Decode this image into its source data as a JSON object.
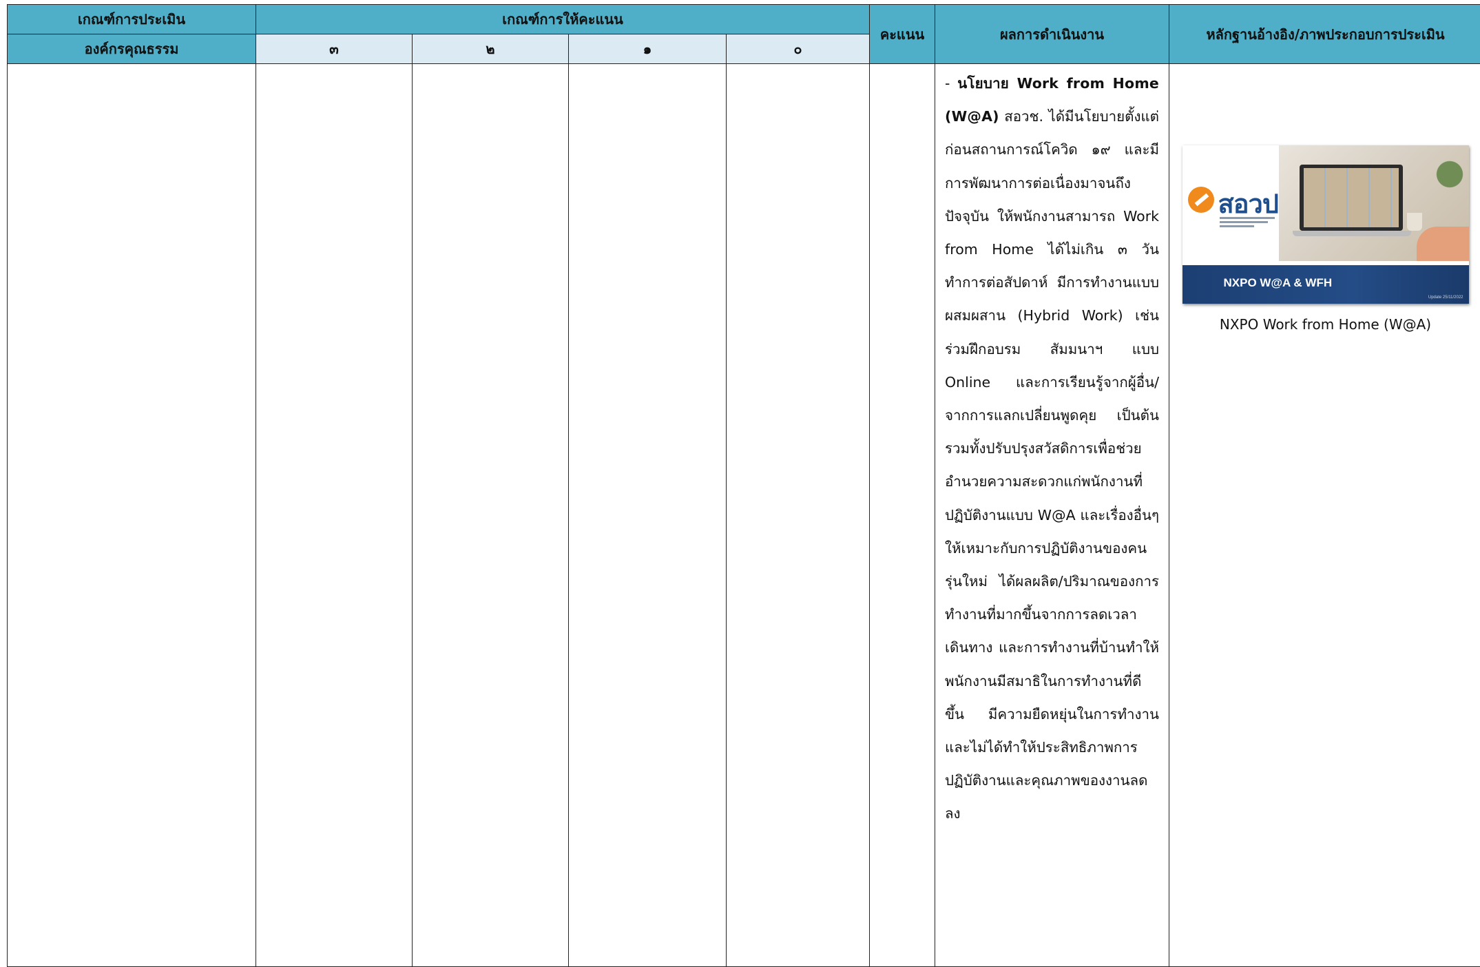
{
  "header": {
    "criteria_line1": "เกณฑ์การประเมิน",
    "criteria_line2": "องค์กรคุณธรรม",
    "scoring": "เกณฑ์การให้คะแนน",
    "score": "คะแนน",
    "result": "ผลการดำเนินงาน",
    "evidence": "หลักฐานอ้างอิง/ภาพประกอบการประเมิน",
    "levels": [
      "๓",
      "๒",
      "๑",
      "๐"
    ]
  },
  "result": {
    "lead_dash": "- ",
    "lead_bold": "นโยบาย Work from Home (W@A)",
    "text": " สอวช. ได้มีนโยบายตั้งแต่ก่อนสถานการณ์โควิด ๑๙ และมีการพัฒนาการต่อเนื่องมาจนถึงปัจจุบัน ให้พนักงานสามารถ Work from Home ได้ไม่เกิน ๓ วันทำการต่อสัปดาห์ มีการทำงานแบบผสมผสาน (Hybrid Work) เช่น ร่วมฝึกอบรม สัมมนาฯ แบบ Online และการเรียนรู้จากผู้อื่น/จากการแลกเปลี่ยนพูดคุย เป็นต้น รวมทั้งปรับปรุงสวัสดิการเพื่อช่วยอำนวยความสะดวกแก่พนักงานที่ปฏิบัติงานแบบ W@A และเรื่องอื่นๆ ให้เหมาะกับการปฏิบัติงานของคนรุ่นใหม่ ได้ผลผลิต/ปริมาณของการทำงานที่มากขึ้นจากการลดเวลาเดินทาง และการทำงานที่บ้านทำให้พนักงานมีสมาธิในการทำงานที่ดีขึ้น มีความยืดหยุ่นในการทำงานและไม่ได้ทำให้ประสิทธิภาพการปฏิบัติงานและคุณภาพของงานลดลง"
  },
  "evidence": {
    "logo_text": "สอวป",
    "banner_title": "NXPO W@A & WFH",
    "banner_date": "Update 25/11/2022",
    "caption": "NXPO Work from Home (W@A)"
  },
  "colors": {
    "header_bg": "#4fafc9",
    "subheader_bg": "#dcebf3",
    "banner_bg": "#1c3f73",
    "logo_accent": "#f08a1c"
  }
}
